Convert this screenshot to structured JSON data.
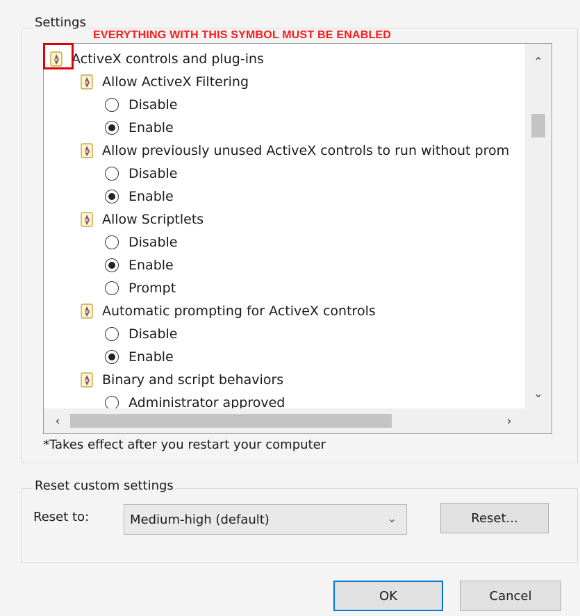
{
  "settings": {
    "legend": "Settings",
    "annotation": "EVERYTHING WITH THIS SYMBOL MUST BE ENABLED",
    "rows": [
      {
        "kind": "category",
        "label": "ActiveX controls and plug-ins"
      },
      {
        "kind": "setting",
        "label": "Allow ActiveX Filtering"
      },
      {
        "kind": "option",
        "label": "Disable",
        "checked": false
      },
      {
        "kind": "option",
        "label": "Enable",
        "checked": true
      },
      {
        "kind": "setting",
        "label": "Allow previously unused ActiveX controls to run without prom"
      },
      {
        "kind": "option",
        "label": "Disable",
        "checked": false
      },
      {
        "kind": "option",
        "label": "Enable",
        "checked": true
      },
      {
        "kind": "setting",
        "label": "Allow Scriptlets"
      },
      {
        "kind": "option",
        "label": "Disable",
        "checked": false
      },
      {
        "kind": "option",
        "label": "Enable",
        "checked": true
      },
      {
        "kind": "option",
        "label": "Prompt",
        "checked": false
      },
      {
        "kind": "setting",
        "label": "Automatic prompting for ActiveX controls"
      },
      {
        "kind": "option",
        "label": "Disable",
        "checked": false
      },
      {
        "kind": "option",
        "label": "Enable",
        "checked": true
      },
      {
        "kind": "setting",
        "label": "Binary and script behaviors"
      },
      {
        "kind": "option",
        "label": "Administrator approved",
        "checked": false
      }
    ],
    "footnote": "*Takes effect after you restart your computer"
  },
  "reset": {
    "legend": "Reset custom settings",
    "reset_to_label": "Reset to:",
    "selected_level": "Medium-high (default)",
    "reset_button": "Reset..."
  },
  "buttons": {
    "ok": "OK",
    "cancel": "Cancel"
  },
  "colors": {
    "annotation": "#ff1a1a",
    "highlight": "#e00000",
    "default_button_border": "#0078d7"
  }
}
